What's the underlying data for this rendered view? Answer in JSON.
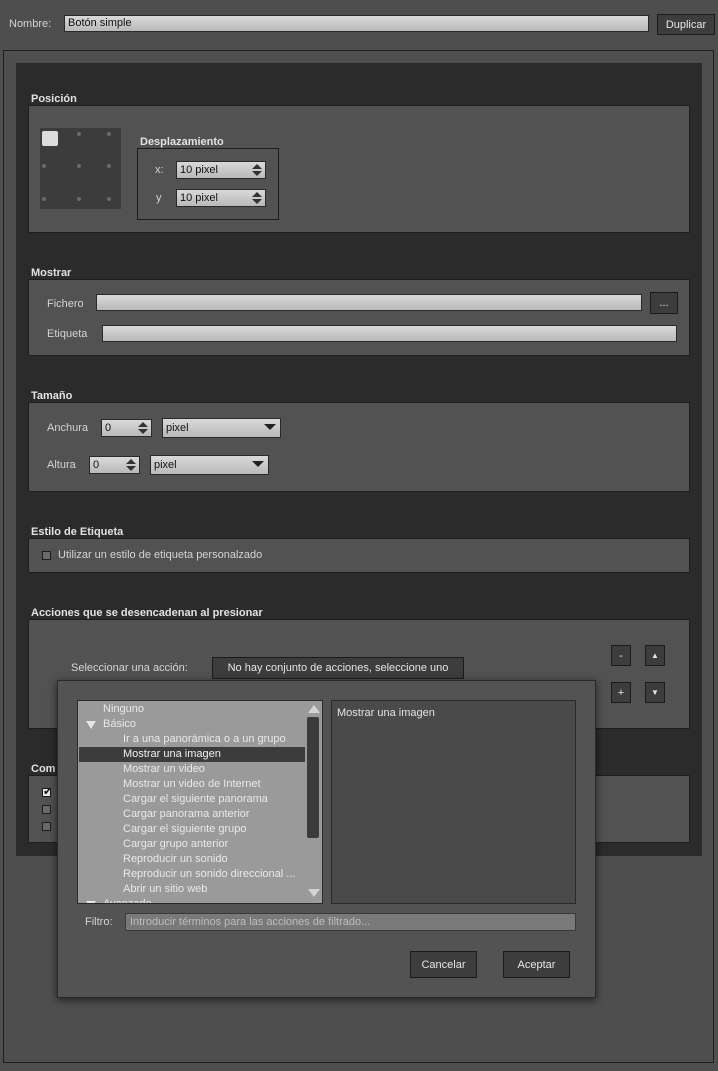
{
  "header": {
    "name_label": "Nombre:",
    "name_value": "Botón simple",
    "duplicate_label": "Duplicar"
  },
  "position": {
    "title": "Posición",
    "offset_title": "Desplazamiento",
    "x_label": "x:",
    "x_value": "10 pixel",
    "y_label": "y",
    "y_value": "10 pixel"
  },
  "display": {
    "title": "Mostrar",
    "file_label": "Fichero",
    "file_value": "",
    "browse_label": "...",
    "tag_label": "Etiqueta",
    "tag_value": ""
  },
  "size": {
    "title": "Tamaño",
    "width_label": "Anchura",
    "width_value": "0",
    "width_unit": "pixel",
    "height_label": "Altura",
    "height_value": "0",
    "height_unit": "pixel"
  },
  "label_style": {
    "title": "Estilo de Etiqueta",
    "custom_label": "Utilizar un estilo de etiqueta personalzado"
  },
  "actions": {
    "title": "Acciones que se desencadenan al presionar",
    "select_label": "Seleccionar una acción:",
    "select_button": "No hay conjunto de acciones, seleccione uno",
    "minus": "-",
    "plus": "+"
  },
  "behavior": {
    "title_partial": "Com"
  },
  "popup": {
    "list": [
      {
        "label": "Ninguno",
        "indent": 0
      },
      {
        "label": "Básico",
        "indent": 0,
        "group": true
      },
      {
        "label": "Ir a una panorámica o a un grupo",
        "indent": 2
      },
      {
        "label": "Mostrar una imagen",
        "indent": 2,
        "selected": true
      },
      {
        "label": "Mostrar un video",
        "indent": 2
      },
      {
        "label": "Mostrar un video de Internet",
        "indent": 2
      },
      {
        "label": "Cargar el siguiente panorama",
        "indent": 2
      },
      {
        "label": "Cargar panorama anterior",
        "indent": 2
      },
      {
        "label": "Cargar el siguiente grupo",
        "indent": 2
      },
      {
        "label": "Cargar grupo anterior",
        "indent": 2
      },
      {
        "label": "Reproducir un sonido",
        "indent": 2
      },
      {
        "label": "Reproducir un sonido direccional ...",
        "indent": 2
      },
      {
        "label": "Abrir un sitio web",
        "indent": 2
      },
      {
        "label": "Avanzado",
        "indent": 0,
        "group": true
      }
    ],
    "description": "Mostrar una imagen",
    "filter_label": "Filtro:",
    "filter_placeholder": "Introducir términos para las acciones de filtrado...",
    "cancel_label": "Cancelar",
    "accept_label": "Aceptar"
  }
}
